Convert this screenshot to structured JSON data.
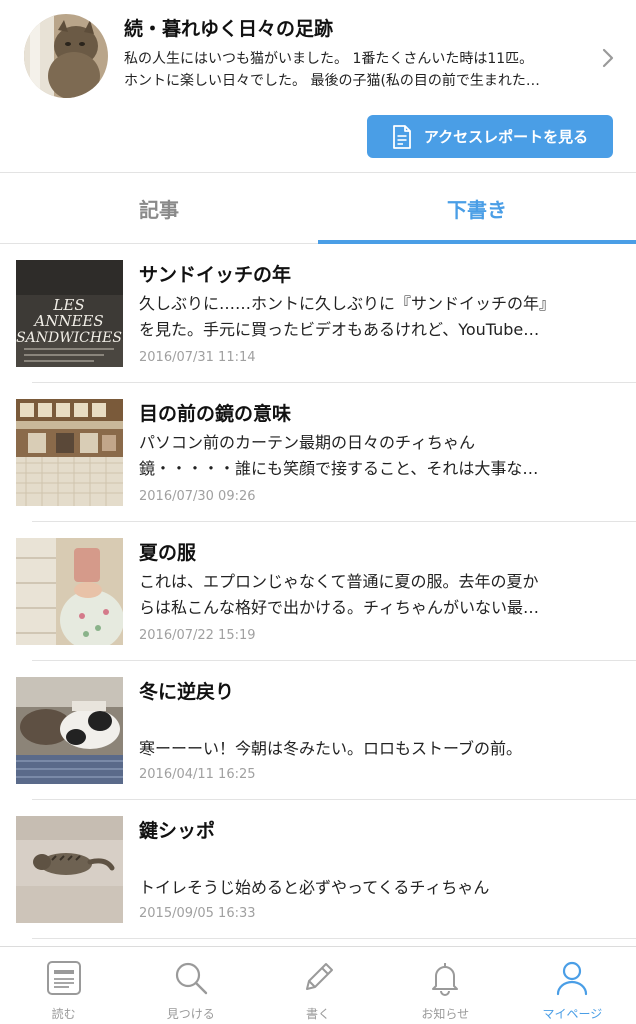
{
  "blog": {
    "title": "続・暮れゆく日々の足跡",
    "desc_line1": "私の人生にはいつも猫がいました。 1番たくさんいた時は11匹。",
    "desc_line2": "ホントに楽しい日々でした。 最後の子猫(私の目の前で生まれた…",
    "report_button": "アクセスレポートを見る"
  },
  "tabs": [
    {
      "label": "記事",
      "active": false
    },
    {
      "label": "下書き",
      "active": true
    }
  ],
  "articles": [
    {
      "title": "サンドイッチの年",
      "excerpt1": "久しぶりに……ホントに久しぶりに『サンドイッチの年』",
      "excerpt2": "を見た。手元に買ったビデオもあるけれど、YouTube…",
      "date": "2016/07/31 11:14",
      "thumb_text1": "LES",
      "thumb_text2": "ANNEES",
      "thumb_text3": "SANDWICHES"
    },
    {
      "title": "目の前の鏡の意味",
      "excerpt1": "パソコン前のカーテン最期の日々のチィちゃん",
      "excerpt2": "鏡・・・・・誰にも笑顔で接すること、それは大事な…",
      "date": "2016/07/30 09:26"
    },
    {
      "title": "夏の服",
      "excerpt1": "これは、エプロンじゃなくて普通に夏の服。去年の夏か",
      "excerpt2": "らは私こんな格好で出かける。チィちゃんがいない最…",
      "date": "2016/07/22 15:19"
    },
    {
      "title": "冬に逆戻り",
      "excerpt1": "寒ーーーい！今朝は冬みたい。ロロもストーブの前。",
      "date": "2016/04/11 16:25"
    },
    {
      "title": "鍵シッポ",
      "excerpt1": "トイレそうじ始めると必ずやってくるチィちゃん",
      "date": "2015/09/05 16:33"
    }
  ],
  "nav": [
    {
      "label": "読む",
      "icon": "read-icon"
    },
    {
      "label": "見つける",
      "icon": "search-icon"
    },
    {
      "label": "書く",
      "icon": "pencil-icon"
    },
    {
      "label": "お知らせ",
      "icon": "bell-icon"
    },
    {
      "label": "マイページ",
      "icon": "person-icon",
      "active": true
    }
  ],
  "colors": {
    "accent": "#4a9ee6",
    "muted": "#9a9a9a",
    "divider": "#e3e3e3"
  }
}
